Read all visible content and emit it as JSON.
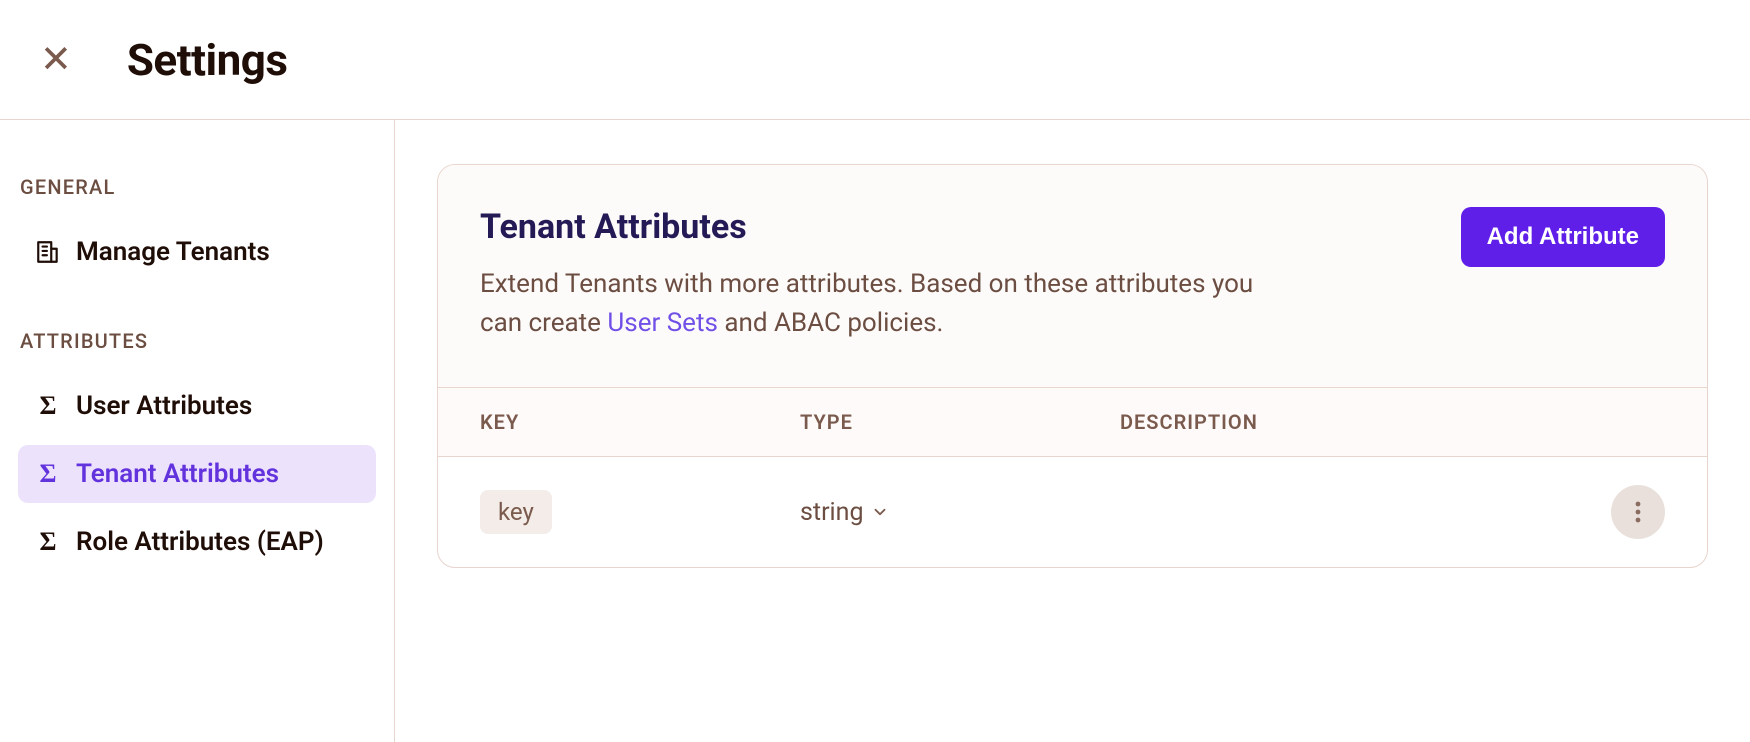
{
  "header": {
    "page_title": "Settings"
  },
  "sidebar": {
    "sections": [
      {
        "label": "GENERAL",
        "items": [
          {
            "label": "Manage Tenants",
            "icon": "building",
            "active": false
          }
        ]
      },
      {
        "label": "ATTRIBUTES",
        "items": [
          {
            "label": "User Attributes",
            "icon": "sigma",
            "active": false
          },
          {
            "label": "Tenant Attributes",
            "icon": "sigma",
            "active": true
          },
          {
            "label": "Role Attributes (EAP)",
            "icon": "sigma",
            "active": false
          }
        ]
      }
    ]
  },
  "card": {
    "title": "Tenant Attributes",
    "desc_pre": "Extend Tenants with more attributes. Based on these attributes you can create ",
    "desc_link": "User Sets",
    "desc_post": " and ABAC policies.",
    "add_button": "Add Attribute"
  },
  "table": {
    "headers": {
      "key": "KEY",
      "type": "TYPE",
      "description": "DESCRIPTION"
    },
    "rows": [
      {
        "key": "key",
        "type": "string",
        "description": ""
      }
    ]
  }
}
